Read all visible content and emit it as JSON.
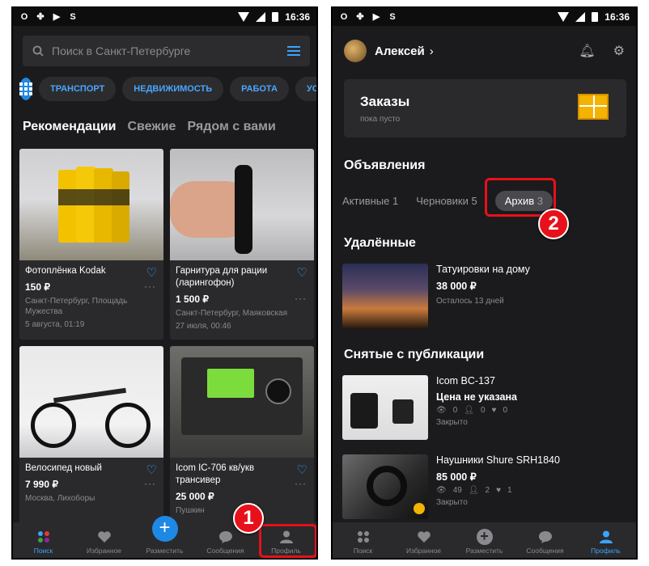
{
  "status": {
    "time": "16:36"
  },
  "left": {
    "search_placeholder": "Поиск в Санкт-Петербурге",
    "chips": [
      "ТРАНСПОРТ",
      "НЕДВИЖИМОСТЬ",
      "РАБОТА",
      "УСЛУ"
    ],
    "tabs": [
      "Рекомендации",
      "Свежие",
      "Рядом с вами"
    ],
    "cards": [
      {
        "title": "Фотоплёнка Kodak",
        "price": "150 ₽",
        "location": "Санкт-Петербург, Площадь Мужества",
        "date": "5 августа, 01:19"
      },
      {
        "title": "Гарнитура для рации (ларингофон)",
        "price": "1 500 ₽",
        "location": "Санкт-Петербург, Маяковская",
        "date": "27 июля, 00:46"
      },
      {
        "title": "Велосипед новый",
        "price": "7 990 ₽",
        "location": "Москва, Лихоборы",
        "date": ""
      },
      {
        "title": "Icom IC-706 кв/укв трансивер",
        "price": "25 000 ₽",
        "location": "Пушкин",
        "date": ""
      }
    ],
    "nav": [
      "Поиск",
      "Избранное",
      "Разместить",
      "Сообщения",
      "Профиль"
    ],
    "callout_number": "1"
  },
  "right": {
    "username": "Алексей",
    "orders_title": "Заказы",
    "orders_sub": "пока пусто",
    "ads_title": "Объявления",
    "ads_tabs": {
      "active": "Активные 1",
      "drafts": "Черновики 5",
      "archive": "Архив",
      "archive_count": "3"
    },
    "deleted_title": "Удалённые",
    "deleted_items": [
      {
        "title": "Татуировки на дому",
        "price": "38 000 ₽",
        "status": "Осталось 13 дней"
      }
    ],
    "removed_title": "Снятые с публикации",
    "removed_items": [
      {
        "title": "Icom BC-137",
        "price": "Цена не указана",
        "views": "0",
        "contacts": "0",
        "favs": "0",
        "status": "Закрыто"
      },
      {
        "title": "Наушники Shure SRH1840",
        "price": "85 000 ₽",
        "views": "49",
        "contacts": "2",
        "favs": "1",
        "status": "Закрыто"
      }
    ],
    "nav": [
      "Поиск",
      "Избранное",
      "Разместить",
      "Сообщения",
      "Профиль"
    ],
    "callout_number": "2"
  },
  "colors": {
    "accent": "#3aa3ff",
    "callout": "#e8101a",
    "background": "#1b1b1d"
  }
}
